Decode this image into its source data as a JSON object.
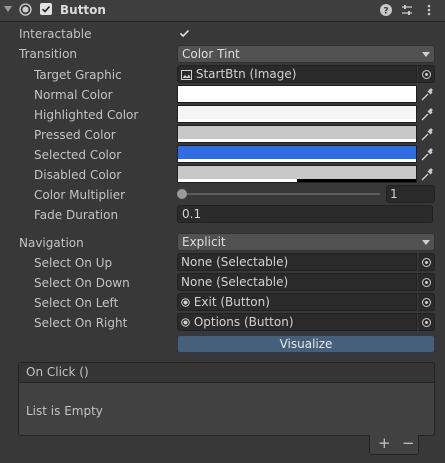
{
  "component": {
    "title": "Button",
    "enabled": true
  },
  "rows": {
    "interactable": {
      "label": "Interactable",
      "checked": true
    },
    "transition": {
      "label": "Transition",
      "value": "Color Tint"
    },
    "target_graphic": {
      "label": "Target Graphic",
      "value": "StartBtn (Image)"
    },
    "normal_color": {
      "label": "Normal Color",
      "color": "#ffffff",
      "alpha": 1.0
    },
    "highlighted_color": {
      "label": "Highlighted Color",
      "color": "#f5f5f5",
      "alpha": 1.0
    },
    "pressed_color": {
      "label": "Pressed Color",
      "color": "#c8c8c8",
      "alpha": 1.0
    },
    "selected_color": {
      "label": "Selected Color",
      "color": "#2f6de0",
      "alpha": 1.0
    },
    "disabled_color": {
      "label": "Disabled Color",
      "color": "#c8c8c8",
      "alpha": 0.5
    },
    "color_multiplier": {
      "label": "Color Multiplier",
      "value": "1",
      "slider_fraction": 0.0
    },
    "fade_duration": {
      "label": "Fade Duration",
      "value": "0.1"
    },
    "navigation": {
      "label": "Navigation",
      "value": "Explicit"
    },
    "select_on_up": {
      "label": "Select On Up",
      "value": "None (Selectable)"
    },
    "select_on_down": {
      "label": "Select On Down",
      "value": "None (Selectable)"
    },
    "select_on_left": {
      "label": "Select On Left",
      "value": "Exit (Button)"
    },
    "select_on_right": {
      "label": "Select On Right",
      "value": "Options (Button)"
    }
  },
  "visualize_label": "Visualize",
  "on_click": {
    "title": "On Click ()",
    "empty_text": "List is Empty",
    "add_label": "+",
    "remove_label": "−"
  }
}
